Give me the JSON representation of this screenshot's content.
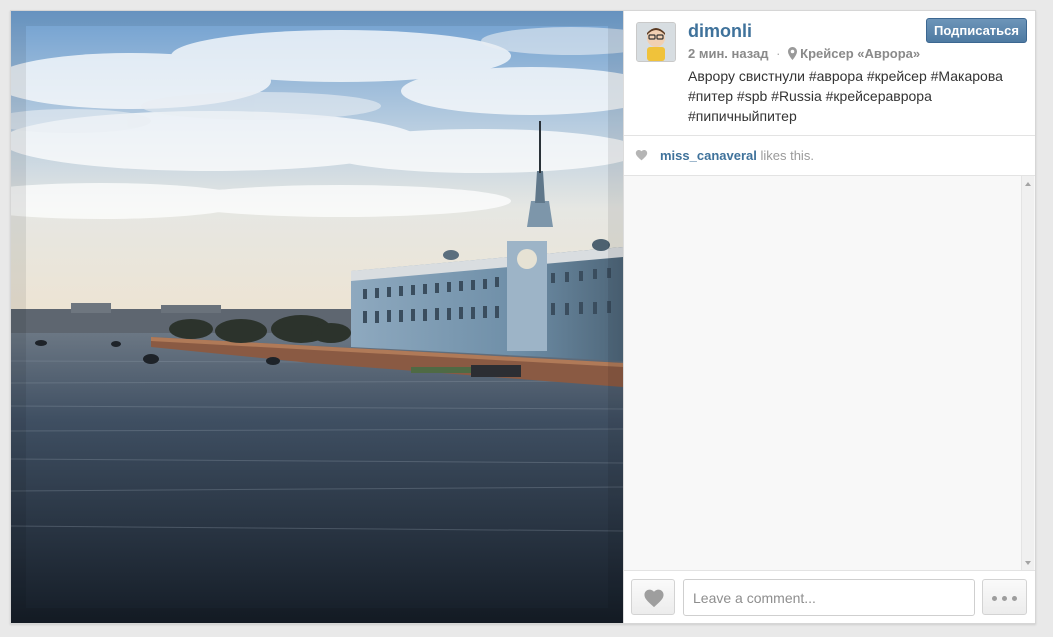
{
  "post": {
    "username": "dimonli",
    "follow_label": "Подписаться",
    "time_ago": "2 мин. назад",
    "separator": "·",
    "location": "Крейсер «Аврора»",
    "caption": "Аврору свистнули #аврора #крейсер #Макарова #питер #spb #Russia #крейсераврора #пипичныйпитер"
  },
  "likes": {
    "liker": "miss_canaveral",
    "suffix": " likes this."
  },
  "comment_box": {
    "placeholder": "Leave a comment..."
  },
  "colors": {
    "link": "#3f729b",
    "follow_button": "#517fa4",
    "muted": "#8a8a8a"
  },
  "icons": {
    "location": "map-pin-icon",
    "like": "heart-icon",
    "more": "ellipsis-icon"
  }
}
